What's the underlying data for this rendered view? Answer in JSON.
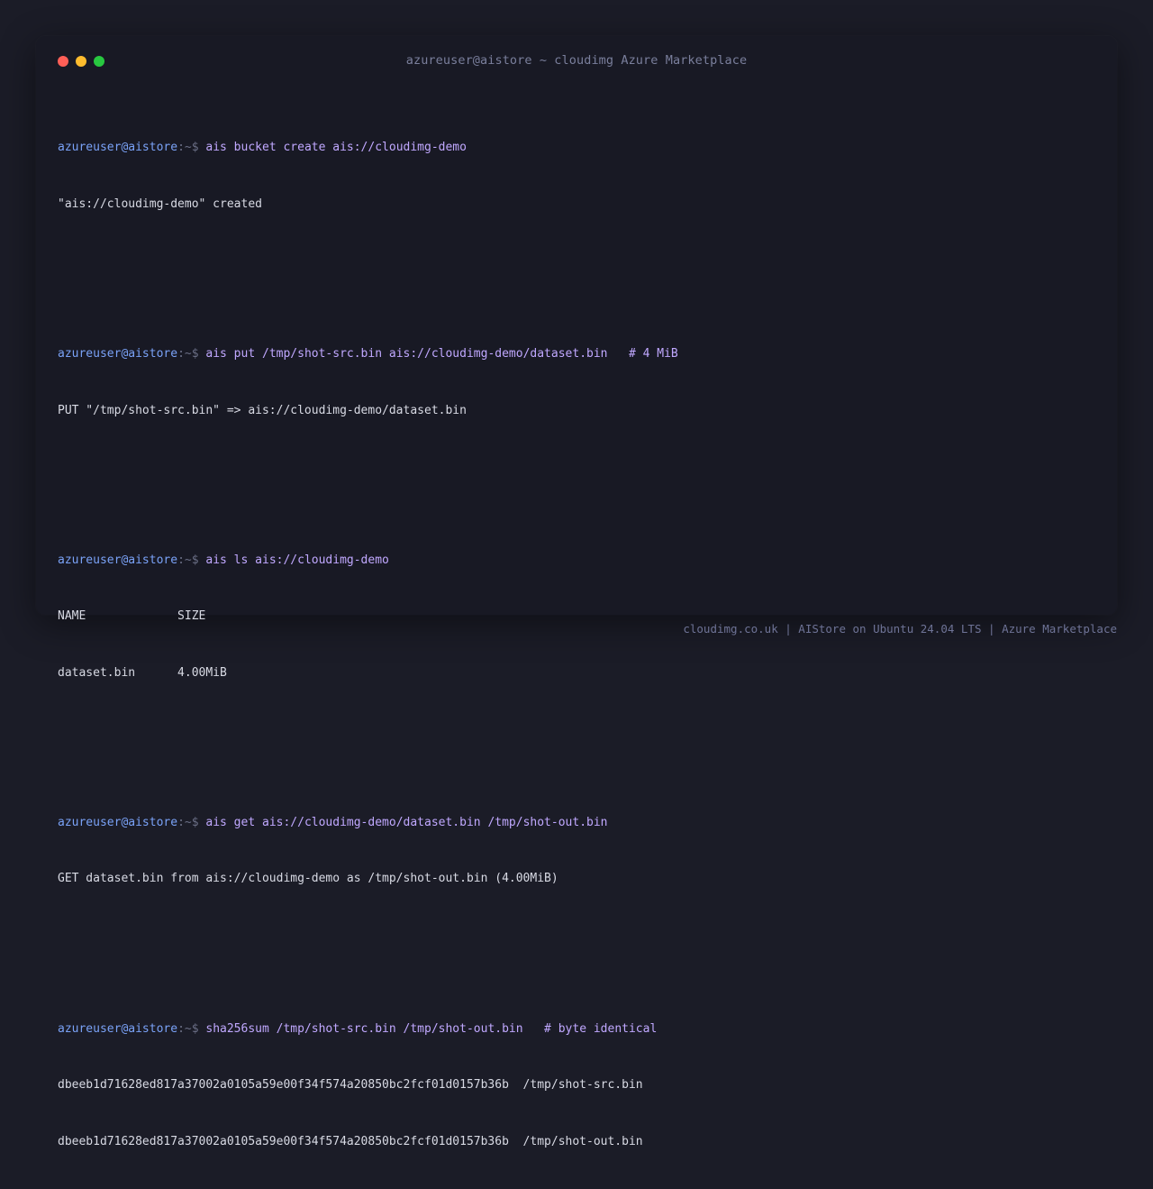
{
  "window": {
    "title": "azureuser@aistore ~ cloudimg Azure Marketplace"
  },
  "prompt": {
    "user_host": "azureuser@aistore",
    "suffix": ":~$ "
  },
  "blocks": [
    {
      "command": "ais bucket create ais://cloudimg-demo",
      "output": [
        "\"ais://cloudimg-demo\" created"
      ]
    },
    {
      "command": "ais put /tmp/shot-src.bin ais://cloudimg-demo/dataset.bin   # 4 MiB",
      "output": [
        "PUT \"/tmp/shot-src.bin\" => ais://cloudimg-demo/dataset.bin"
      ]
    },
    {
      "command": "ais ls ais://cloudimg-demo",
      "output": [
        "NAME             SIZE",
        "dataset.bin      4.00MiB"
      ]
    },
    {
      "command": "ais get ais://cloudimg-demo/dataset.bin /tmp/shot-out.bin",
      "output": [
        "GET dataset.bin from ais://cloudimg-demo as /tmp/shot-out.bin (4.00MiB)"
      ]
    },
    {
      "command": "sha256sum /tmp/shot-src.bin /tmp/shot-out.bin   # byte identical",
      "output": [
        "dbeeb1d71628ed817a37002a0105a59e00f34f574a20850bc2fcf01d0157b36b  /tmp/shot-src.bin",
        "dbeeb1d71628ed817a37002a0105a59e00f34f574a20850bc2fcf01d0157b36b  /tmp/shot-out.bin"
      ]
    }
  ],
  "footer": {
    "text": "cloudimg.co.uk | AIStore on Ubuntu 24.04 LTS | Azure Marketplace"
  },
  "colors": {
    "background": "#1b1c27",
    "window": "#181924",
    "user": "#7aa2f7",
    "command": "#c0a8ff",
    "output": "#d8dae4",
    "close": "#ff5f57",
    "minimize": "#febc2e",
    "maximize": "#28c840"
  }
}
